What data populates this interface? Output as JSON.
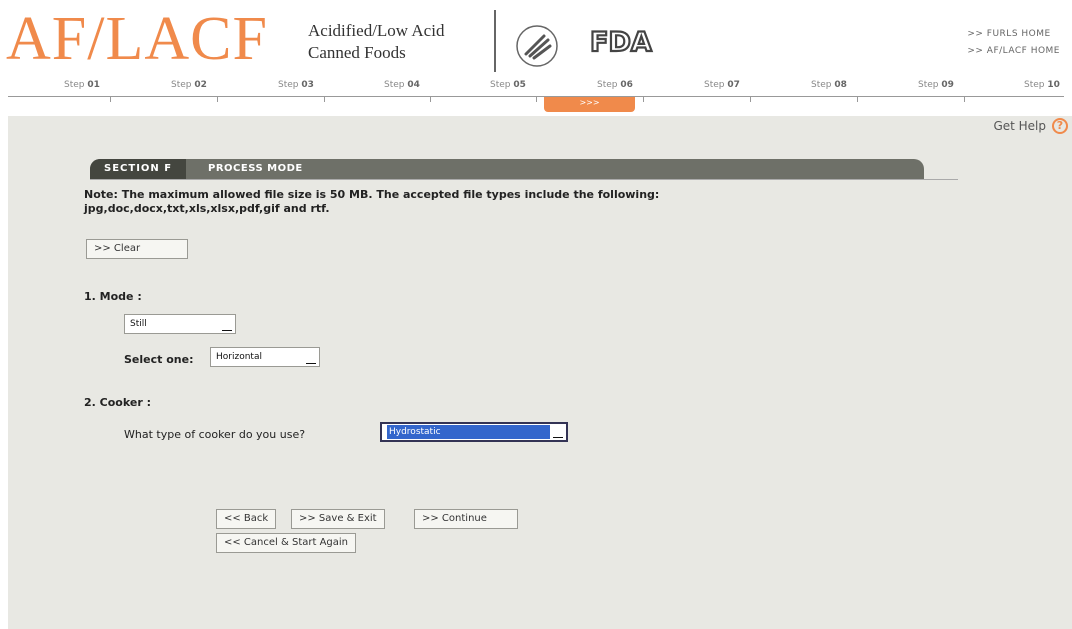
{
  "header": {
    "logo": "AF/LACF",
    "subtitle_line1": "Acidified/Low Acid",
    "subtitle_line2": "Canned Foods",
    "fda": "FDA",
    "links": [
      ">> FURLS HOME",
      ">> AF/LACF HOME"
    ]
  },
  "steps": [
    {
      "prefix": "Step",
      "num": "01"
    },
    {
      "prefix": "Step",
      "num": "02"
    },
    {
      "prefix": "Step",
      "num": "03"
    },
    {
      "prefix": "Step",
      "num": "04"
    },
    {
      "prefix": "Step",
      "num": "05"
    },
    {
      "prefix": "Step",
      "num": "06"
    },
    {
      "prefix": "Step",
      "num": "07"
    },
    {
      "prefix": "Step",
      "num": "08"
    },
    {
      "prefix": "Step",
      "num": "09"
    },
    {
      "prefix": "Step",
      "num": "10"
    }
  ],
  "active_step_marker": ">>>",
  "help": {
    "label": "Get Help",
    "icon": "help-icon"
  },
  "section": {
    "tab": "SECTION F",
    "title": "PROCESS MODE"
  },
  "note": "Note: The maximum allowed file size is 50 MB. The accepted file types include the following: jpg,doc,docx,txt,xls,xlsx,pdf,gif and rtf.",
  "buttons": {
    "clear": ">> Clear",
    "back": "<< Back",
    "save_exit": ">> Save & Exit",
    "continue": ">> Continue",
    "cancel": "<< Cancel & Start Again"
  },
  "form": {
    "mode_label": "1. Mode :",
    "mode_value": "Still",
    "select_one_label": "Select one:",
    "select_one_value": "Horizontal",
    "cooker_label": "2. Cooker :",
    "cooker_question": "What type of cooker do you use?",
    "cooker_value": "Hydrostatic"
  },
  "colors": {
    "accent": "#f08a4b",
    "panel": "#e8e8e3",
    "section_bar": "#6e7068"
  }
}
